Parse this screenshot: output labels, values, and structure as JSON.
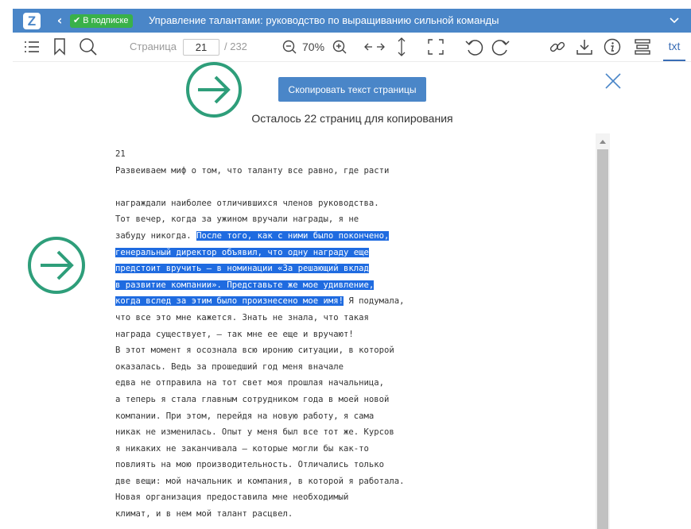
{
  "topbar": {
    "logo_letter": "Z",
    "back_glyph": "‹",
    "badge_check": "✔",
    "badge_label": "В подписке",
    "title": "Управление талантами: руководство по выращиванию сильной команды",
    "accent": "#4a86c8",
    "badge_color": "#39b149"
  },
  "toolbar": {
    "page_label": "Страница",
    "page_value": "21",
    "page_total": "/ 232",
    "zoom_value": "70%",
    "txt_tab": "txt",
    "icons": [
      "menu-icon",
      "bookmark-icon",
      "search-icon",
      "zoom-out-icon",
      "zoom-in-icon",
      "fit-width-icon",
      "fit-height-icon",
      "fullscreen-icon",
      "rotate-left-icon",
      "rotate-right-icon",
      "link-icon",
      "download-icon",
      "info-icon",
      "layers-icon"
    ]
  },
  "content": {
    "copy_button": "Скопировать текст страницы",
    "remaining": "Осталось 22 страниц для копирования",
    "selection_color": "#1f6be0",
    "lines": [
      {
        "pre": "21",
        "sel": "",
        "post": ""
      },
      {
        "pre": "Развеиваем миф о том, что таланту все равно, где расти",
        "sel": "",
        "post": ""
      },
      {
        "pre": "",
        "sel": "",
        "post": ""
      },
      {
        "pre": "награждали наиболее отличившихся членов руководства.",
        "sel": "",
        "post": ""
      },
      {
        "pre": "Тот вечер, когда за ужином вручали награды, я не",
        "sel": "",
        "post": ""
      },
      {
        "pre": "забуду никогда. ",
        "sel": "После того, как с ними было покончено,",
        "post": ""
      },
      {
        "pre": "",
        "sel": "генеральный директор объявил, что одну награду еще",
        "post": ""
      },
      {
        "pre": "",
        "sel": "предстоит вручить — в номинации «За решающий вклад",
        "post": ""
      },
      {
        "pre": "",
        "sel": "в развитие компании». Представьте же мое удивление,",
        "post": ""
      },
      {
        "pre": "",
        "sel": "когда вслед за этим было произнесено мое имя!",
        "post": " Я подумала,"
      },
      {
        "pre": "что все это мне кажется. Знать не знала, что такая",
        "sel": "",
        "post": ""
      },
      {
        "pre": "награда существует, — так мне ее еще и вручают!",
        "sel": "",
        "post": ""
      },
      {
        "pre": "В этот момент я осознала всю иронию ситуации, в которой",
        "sel": "",
        "post": ""
      },
      {
        "pre": "оказалась. Ведь за прошедший год меня вначале",
        "sel": "",
        "post": ""
      },
      {
        "pre": "едва не отправила на тот свет моя прошлая начальница,",
        "sel": "",
        "post": ""
      },
      {
        "pre": "а теперь я стала главным сотрудником года в моей новой",
        "sel": "",
        "post": ""
      },
      {
        "pre": "компании. При этом, перейдя на новую работу, я сама",
        "sel": "",
        "post": ""
      },
      {
        "pre": "никак не изменилась. Опыт у меня был все тот же. Курсов",
        "sel": "",
        "post": ""
      },
      {
        "pre": "я никаких не заканчивала — которые могли бы как-то",
        "sel": "",
        "post": ""
      },
      {
        "pre": "повлиять на мою производительность. Отличались только",
        "sel": "",
        "post": ""
      },
      {
        "pre": "две вещи: мой начальник и компания, в которой я работала.",
        "sel": "",
        "post": ""
      },
      {
        "pre": "Новая организация предоставила мне необходимый",
        "sel": "",
        "post": ""
      },
      {
        "pre": "климат, и в нем мой талант расцвел.",
        "sel": "",
        "post": ""
      }
    ]
  },
  "overlay": {
    "arrow_color": "#2e9e7a"
  }
}
